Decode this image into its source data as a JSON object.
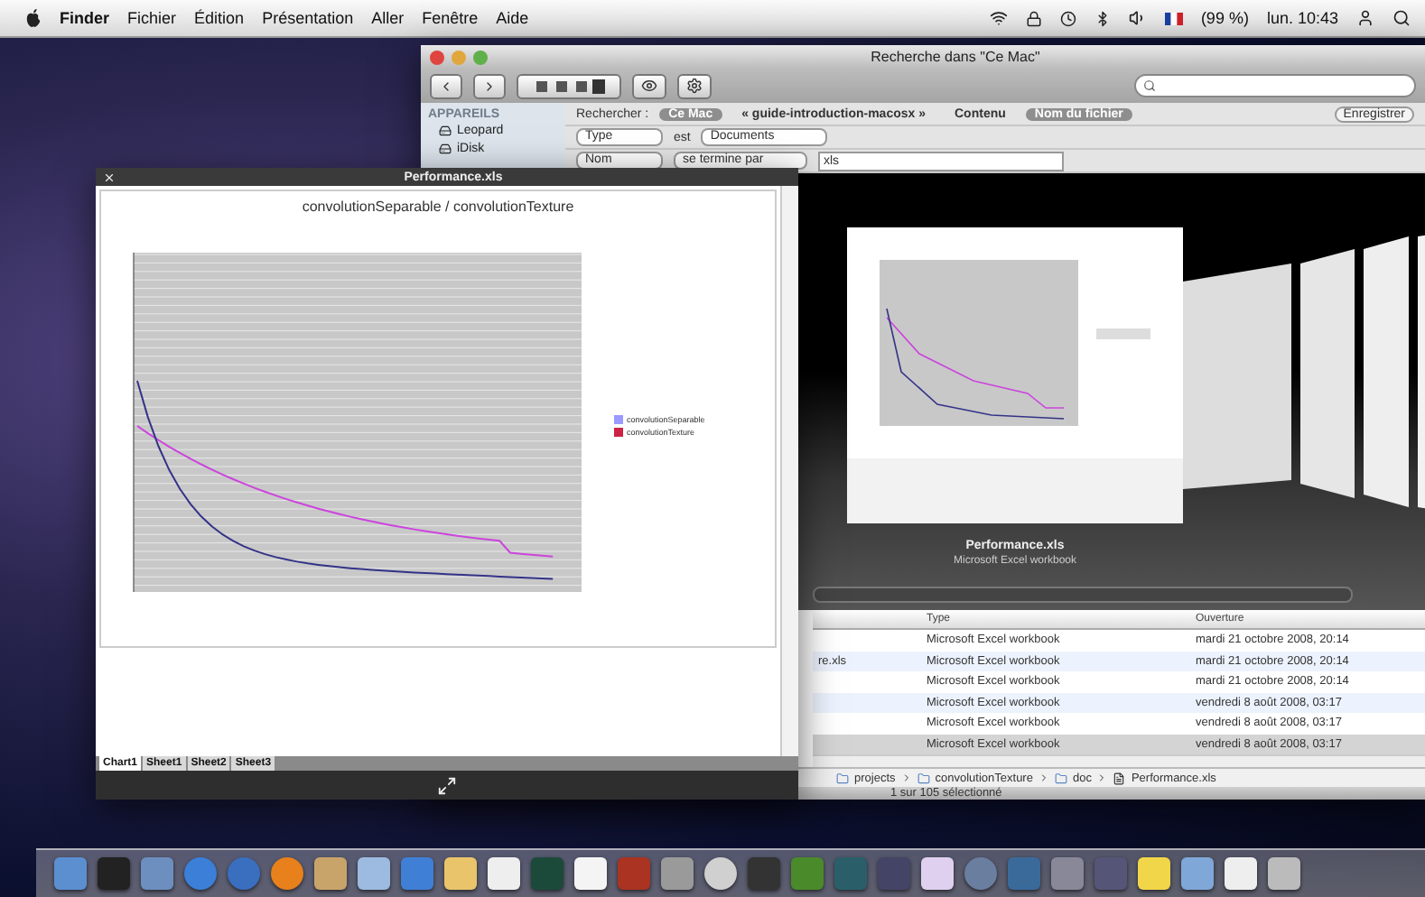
{
  "menu_bar": {
    "app": "Finder",
    "menus": [
      "Fichier",
      "Édition",
      "Présentation",
      "Aller",
      "Fenêtre",
      "Aide"
    ],
    "battery": "(99 %)",
    "clock": "lun. 10:43"
  },
  "finder": {
    "title": "Recherche dans \"Ce Mac\"",
    "sidebar": {
      "heading": "APPAREILS",
      "items": [
        {
          "label": "Leopard",
          "selected": false
        },
        {
          "label": "iDisk",
          "selected": false
        }
      ]
    },
    "search_bar": {
      "label": "Rechercher :",
      "scopes": [
        {
          "label": "Ce Mac",
          "selected": true
        },
        {
          "label": "« guide-introduction-macosx »",
          "selected": false
        }
      ],
      "attributes": [
        {
          "label": "Contenu",
          "selected": false
        },
        {
          "label": "Nom du fichier",
          "selected": true
        }
      ],
      "save": "Enregistrer"
    },
    "criteria": [
      {
        "kind": "label",
        "attribute": "Type",
        "operator": "est",
        "value": "Documents"
      },
      {
        "kind": "field",
        "attribute": "Nom",
        "operator": "se termine par",
        "value": "xls"
      }
    ],
    "cover_flow": {
      "name": "Performance.xls",
      "kind": "Microsoft Excel workbook"
    },
    "list": {
      "columns": [
        "Type",
        "Ouverture"
      ],
      "rows": [
        {
          "type": "Microsoft Excel workbook",
          "opened": "mardi 21 octobre 2008, 20:14",
          "selected": false
        },
        {
          "name": "re.xls",
          "type": "Microsoft Excel workbook",
          "opened": "mardi 21 octobre 2008, 20:14",
          "selected": false
        },
        {
          "type": "Microsoft Excel workbook",
          "opened": "mardi 21 octobre 2008, 20:14",
          "selected": false
        },
        {
          "type": "Microsoft Excel workbook",
          "opened": "vendredi 8 août 2008, 03:17",
          "selected": false
        },
        {
          "type": "Microsoft Excel workbook",
          "opened": "vendredi 8 août 2008, 03:17",
          "selected": false
        },
        {
          "type": "Microsoft Excel workbook",
          "opened": "vendredi 8 août 2008, 03:17",
          "selected": true
        }
      ]
    },
    "path": [
      "projects",
      "convolutionTexture",
      "doc",
      "Performance.xls"
    ],
    "status": "1 sur 105 sélectionné"
  },
  "quick_look": {
    "title": "Performance.xls",
    "chart_title": "convolutionSeparable / convolutionTexture",
    "legend": [
      {
        "label": "convolutionSeparable",
        "color": "#9a9aff"
      },
      {
        "label": "convolutionTexture",
        "color": "#cc2244"
      }
    ],
    "sheets": [
      {
        "label": "Chart1",
        "selected": true
      },
      {
        "label": "Sheet1",
        "selected": false
      },
      {
        "label": "Sheet2",
        "selected": false
      },
      {
        "label": "Sheet3",
        "selected": false
      }
    ]
  }
}
